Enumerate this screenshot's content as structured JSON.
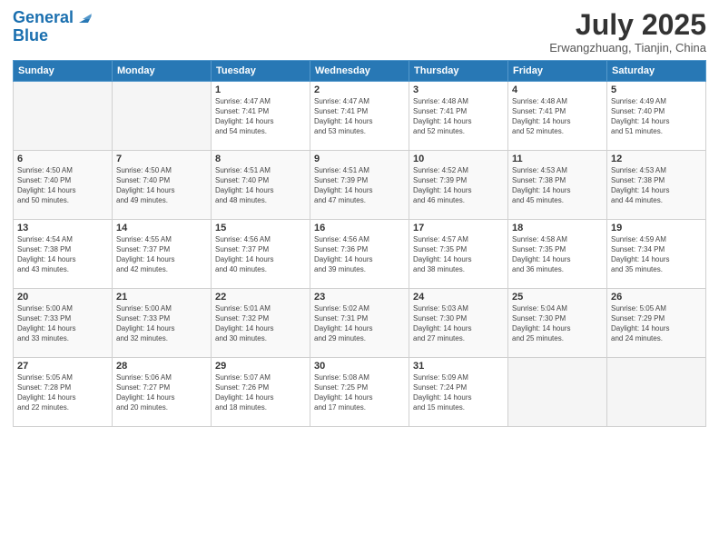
{
  "header": {
    "logo_line1": "General",
    "logo_line2": "Blue",
    "month": "July 2025",
    "location": "Erwangzhuang, Tianjin, China"
  },
  "weekdays": [
    "Sunday",
    "Monday",
    "Tuesday",
    "Wednesday",
    "Thursday",
    "Friday",
    "Saturday"
  ],
  "weeks": [
    [
      {
        "num": "",
        "detail": ""
      },
      {
        "num": "",
        "detail": ""
      },
      {
        "num": "1",
        "detail": "Sunrise: 4:47 AM\nSunset: 7:41 PM\nDaylight: 14 hours\nand 54 minutes."
      },
      {
        "num": "2",
        "detail": "Sunrise: 4:47 AM\nSunset: 7:41 PM\nDaylight: 14 hours\nand 53 minutes."
      },
      {
        "num": "3",
        "detail": "Sunrise: 4:48 AM\nSunset: 7:41 PM\nDaylight: 14 hours\nand 52 minutes."
      },
      {
        "num": "4",
        "detail": "Sunrise: 4:48 AM\nSunset: 7:41 PM\nDaylight: 14 hours\nand 52 minutes."
      },
      {
        "num": "5",
        "detail": "Sunrise: 4:49 AM\nSunset: 7:40 PM\nDaylight: 14 hours\nand 51 minutes."
      }
    ],
    [
      {
        "num": "6",
        "detail": "Sunrise: 4:50 AM\nSunset: 7:40 PM\nDaylight: 14 hours\nand 50 minutes."
      },
      {
        "num": "7",
        "detail": "Sunrise: 4:50 AM\nSunset: 7:40 PM\nDaylight: 14 hours\nand 49 minutes."
      },
      {
        "num": "8",
        "detail": "Sunrise: 4:51 AM\nSunset: 7:40 PM\nDaylight: 14 hours\nand 48 minutes."
      },
      {
        "num": "9",
        "detail": "Sunrise: 4:51 AM\nSunset: 7:39 PM\nDaylight: 14 hours\nand 47 minutes."
      },
      {
        "num": "10",
        "detail": "Sunrise: 4:52 AM\nSunset: 7:39 PM\nDaylight: 14 hours\nand 46 minutes."
      },
      {
        "num": "11",
        "detail": "Sunrise: 4:53 AM\nSunset: 7:38 PM\nDaylight: 14 hours\nand 45 minutes."
      },
      {
        "num": "12",
        "detail": "Sunrise: 4:53 AM\nSunset: 7:38 PM\nDaylight: 14 hours\nand 44 minutes."
      }
    ],
    [
      {
        "num": "13",
        "detail": "Sunrise: 4:54 AM\nSunset: 7:38 PM\nDaylight: 14 hours\nand 43 minutes."
      },
      {
        "num": "14",
        "detail": "Sunrise: 4:55 AM\nSunset: 7:37 PM\nDaylight: 14 hours\nand 42 minutes."
      },
      {
        "num": "15",
        "detail": "Sunrise: 4:56 AM\nSunset: 7:37 PM\nDaylight: 14 hours\nand 40 minutes."
      },
      {
        "num": "16",
        "detail": "Sunrise: 4:56 AM\nSunset: 7:36 PM\nDaylight: 14 hours\nand 39 minutes."
      },
      {
        "num": "17",
        "detail": "Sunrise: 4:57 AM\nSunset: 7:35 PM\nDaylight: 14 hours\nand 38 minutes."
      },
      {
        "num": "18",
        "detail": "Sunrise: 4:58 AM\nSunset: 7:35 PM\nDaylight: 14 hours\nand 36 minutes."
      },
      {
        "num": "19",
        "detail": "Sunrise: 4:59 AM\nSunset: 7:34 PM\nDaylight: 14 hours\nand 35 minutes."
      }
    ],
    [
      {
        "num": "20",
        "detail": "Sunrise: 5:00 AM\nSunset: 7:33 PM\nDaylight: 14 hours\nand 33 minutes."
      },
      {
        "num": "21",
        "detail": "Sunrise: 5:00 AM\nSunset: 7:33 PM\nDaylight: 14 hours\nand 32 minutes."
      },
      {
        "num": "22",
        "detail": "Sunrise: 5:01 AM\nSunset: 7:32 PM\nDaylight: 14 hours\nand 30 minutes."
      },
      {
        "num": "23",
        "detail": "Sunrise: 5:02 AM\nSunset: 7:31 PM\nDaylight: 14 hours\nand 29 minutes."
      },
      {
        "num": "24",
        "detail": "Sunrise: 5:03 AM\nSunset: 7:30 PM\nDaylight: 14 hours\nand 27 minutes."
      },
      {
        "num": "25",
        "detail": "Sunrise: 5:04 AM\nSunset: 7:30 PM\nDaylight: 14 hours\nand 25 minutes."
      },
      {
        "num": "26",
        "detail": "Sunrise: 5:05 AM\nSunset: 7:29 PM\nDaylight: 14 hours\nand 24 minutes."
      }
    ],
    [
      {
        "num": "27",
        "detail": "Sunrise: 5:05 AM\nSunset: 7:28 PM\nDaylight: 14 hours\nand 22 minutes."
      },
      {
        "num": "28",
        "detail": "Sunrise: 5:06 AM\nSunset: 7:27 PM\nDaylight: 14 hours\nand 20 minutes."
      },
      {
        "num": "29",
        "detail": "Sunrise: 5:07 AM\nSunset: 7:26 PM\nDaylight: 14 hours\nand 18 minutes."
      },
      {
        "num": "30",
        "detail": "Sunrise: 5:08 AM\nSunset: 7:25 PM\nDaylight: 14 hours\nand 17 minutes."
      },
      {
        "num": "31",
        "detail": "Sunrise: 5:09 AM\nSunset: 7:24 PM\nDaylight: 14 hours\nand 15 minutes."
      },
      {
        "num": "",
        "detail": ""
      },
      {
        "num": "",
        "detail": ""
      }
    ]
  ]
}
